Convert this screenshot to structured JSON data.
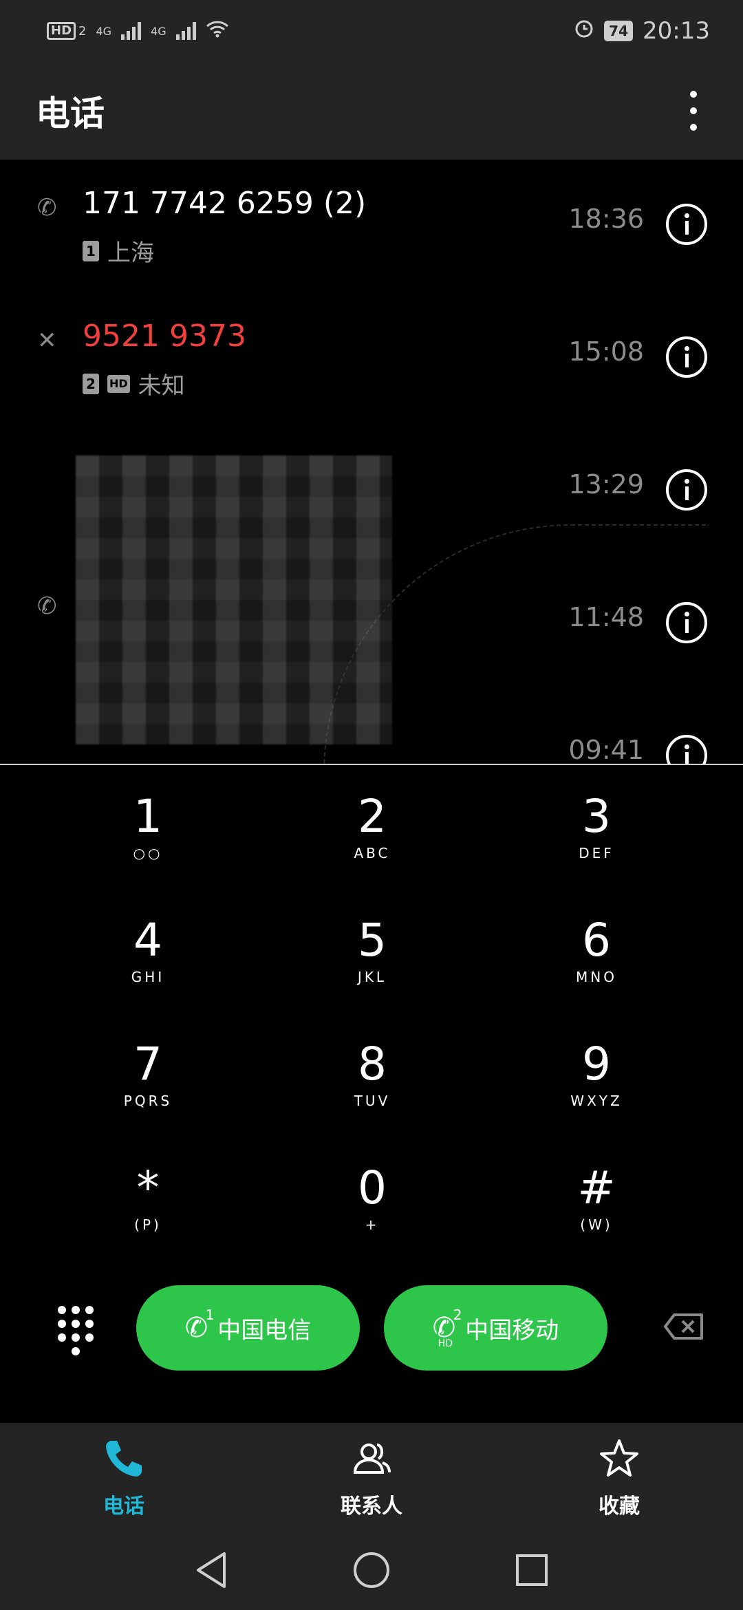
{
  "status_bar": {
    "hd_label": "HD",
    "sim2_label": "2",
    "net1": "4G",
    "net2": "4G",
    "battery": "74",
    "time": "20:13"
  },
  "app_bar": {
    "title": "电话"
  },
  "call_log": [
    {
      "number": "171 7742 6259  (2)",
      "sim": "1",
      "hd": "",
      "location": "上海",
      "time": "18:36",
      "type": "outgoing",
      "color": "#ffffff"
    },
    {
      "number": "9521 9373",
      "sim": "2",
      "hd": "HD",
      "location": "未知",
      "time": "15:08",
      "type": "missed",
      "color": "#f0403c"
    },
    {
      "number": "",
      "sim": "",
      "hd": "",
      "location": "",
      "time": "13:29",
      "type": "outgoing",
      "color": "#ffffff"
    },
    {
      "number": "",
      "sim": "",
      "hd": "",
      "location": "",
      "time": "11:48",
      "type": "outgoing",
      "color": "#ffffff"
    },
    {
      "number": "",
      "sim": "",
      "hd": "",
      "location": "",
      "time": "09:41",
      "type": "outgoing",
      "color": "#ffffff"
    }
  ],
  "dialpad": [
    {
      "digit": "1",
      "letters": "○○"
    },
    {
      "digit": "2",
      "letters": "ABC"
    },
    {
      "digit": "3",
      "letters": "DEF"
    },
    {
      "digit": "4",
      "letters": "GHI"
    },
    {
      "digit": "5",
      "letters": "JKL"
    },
    {
      "digit": "6",
      "letters": "MNO"
    },
    {
      "digit": "7",
      "letters": "PQRS"
    },
    {
      "digit": "8",
      "letters": "TUV"
    },
    {
      "digit": "9",
      "letters": "WXYZ"
    },
    {
      "digit": "*",
      "letters": "(P)"
    },
    {
      "digit": "0",
      "letters": "+"
    },
    {
      "digit": "#",
      "letters": "(W)"
    }
  ],
  "actions": {
    "call_sim1_label": "中国电信",
    "call_sim1_num": "1",
    "call_sim2_label": "中国移动",
    "call_sim2_num": "2",
    "call_sim2_hd": "HD",
    "accent": "#2ec64a"
  },
  "bottom_nav": {
    "phone": "电话",
    "contacts": "联系人",
    "favorites": "收藏",
    "active_color": "#21b8d8"
  }
}
